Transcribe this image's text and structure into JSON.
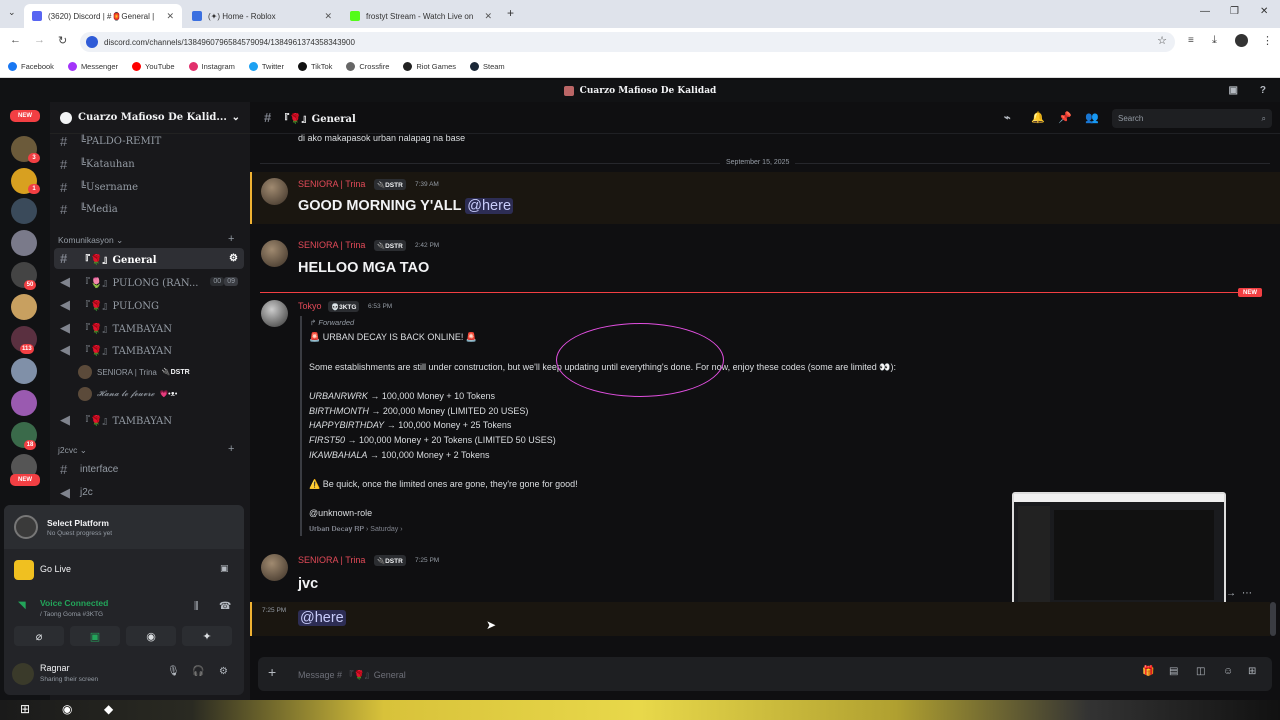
{
  "browser": {
    "tabs": [
      {
        "title": "(3620) Discord | #🏮General |",
        "active": true,
        "color": "#5865f2"
      },
      {
        "title": "(✦) Home - Roblox",
        "active": false,
        "color": "#3a6fe0"
      },
      {
        "title": "frostyt Stream - Watch Live on",
        "active": false,
        "color": "#53fc18"
      }
    ],
    "url": "discord.com/channels/1384960796584579094/1384961374358343900",
    "bookmarks": [
      "Facebook",
      "Messenger",
      "YouTube",
      "Instagram",
      "Twitter",
      "TikTok",
      "Crossfire",
      "Riot Games",
      "Steam"
    ]
  },
  "discord": {
    "window_title": "Cuarzo Mafioso De Kalidad",
    "server_name": "Cuarzo Mafioso De Kalid...",
    "rail_badges": [
      "NEW",
      "3",
      "1",
      "50",
      "113",
      "18",
      "NEW"
    ],
    "channels_top": [
      "╚PALDO-REMIT",
      "╚Katauhan",
      "╚Username",
      "╚Media"
    ],
    "category_1": "Komunikasyon",
    "channels_voice": [
      {
        "label": "『🌹』General",
        "selected": true
      },
      {
        "label": "『🌷』PULONG (RAN...",
        "counter_a": "00",
        "counter_b": "09"
      },
      {
        "label": "『🌹』PULONG"
      },
      {
        "label": "『🌹』TAMBAYAN"
      },
      {
        "label": "『🌹』TAMBAYAN"
      }
    ],
    "voice_users": [
      {
        "name": "SENIORA | Trina",
        "tag": "🔌DSTR"
      },
      {
        "name": "𝓗𝓪𝓷𝓪 𝓵𝓮 𝓯𝓮𝓾𝓿𝓻𝓮",
        "tag": "💗•ᴥ•"
      }
    ],
    "channel_after": "『🌹』TAMBAYAN",
    "category_2": "j2cvc",
    "channels_j2c": [
      "interface",
      "j2c"
    ],
    "panel": {
      "platform_title": "Select Platform",
      "platform_sub": "No Quest progress yet",
      "go_live": "Go Live",
      "voice_title": "Voice Connected",
      "voice_sub": "/ Taong Goma #3KTG",
      "user_name": "Ragnar",
      "user_status": "Sharing their screen"
    },
    "chat_header": "『🌹』General",
    "search_placeholder": "Search",
    "messages": {
      "prev_line": "di ako makapasok urban nalapag na base",
      "date_divider": "September 15, 2025",
      "m1": {
        "author": "SENIORA | Trina",
        "tag": "🔌DSTR",
        "time": "7:39 AM",
        "text": "GOOD MORNING Y'ALL",
        "mention": "@here"
      },
      "m2": {
        "author": "SENIORA | Trina",
        "tag": "🔌DSTR",
        "time": "2:42 PM",
        "text": "HELLOO MGA TAO"
      },
      "new_label": "NEW",
      "m3": {
        "author": "Tokyo",
        "tag": "💀3KTG",
        "time": "6:53 PM",
        "forwarded": "Forwarded",
        "title": "🚨 URBAN DECAY IS BACK ONLINE! 🚨",
        "intro": "Some establishments are still under construction, but we'll keep updating until everything's done. For now, enjoy these codes (some are limited 👀):",
        "codes": [
          {
            "code": "URBANRWRK",
            "reward": " → 100,000 Money + 10 Tokens"
          },
          {
            "code": "BIRTHMONTH",
            "reward": " → 200,000 Money (LIMITED 20 USES)"
          },
          {
            "code": "HAPPYBIRTHDAY",
            "reward": " → 100,000 Money + 25 Tokens"
          },
          {
            "code": "FIRST50",
            "reward": " → 100,000 Money + 20 Tokens (LIMITED 50 USES)"
          },
          {
            "code": "IKAWBAHALA",
            "reward": " → 100,000 Money + 2 Tokens"
          }
        ],
        "warning": "⚠️ Be quick, once the limited ones are gone, they're gone for good!",
        "role": "@unknown-role",
        "source": "𝐔𝐫𝐛𝐚𝐧 𝐃𝐞𝐜𝐚𝐲 𝐑𝐏 › Saturday ›"
      },
      "m4": {
        "author": "SENIORA | Trina",
        "tag": "🔌DSTR",
        "time": "7:25 PM",
        "text": "jvc"
      },
      "m5": {
        "time": "7:25 PM",
        "mention": "@here"
      }
    },
    "composer_placeholder": "Message # 『🌹』General"
  },
  "colors": {
    "accent": "#5865f2",
    "author": "#e24a58",
    "online": "#23a55a",
    "danger": "#f23f43"
  }
}
